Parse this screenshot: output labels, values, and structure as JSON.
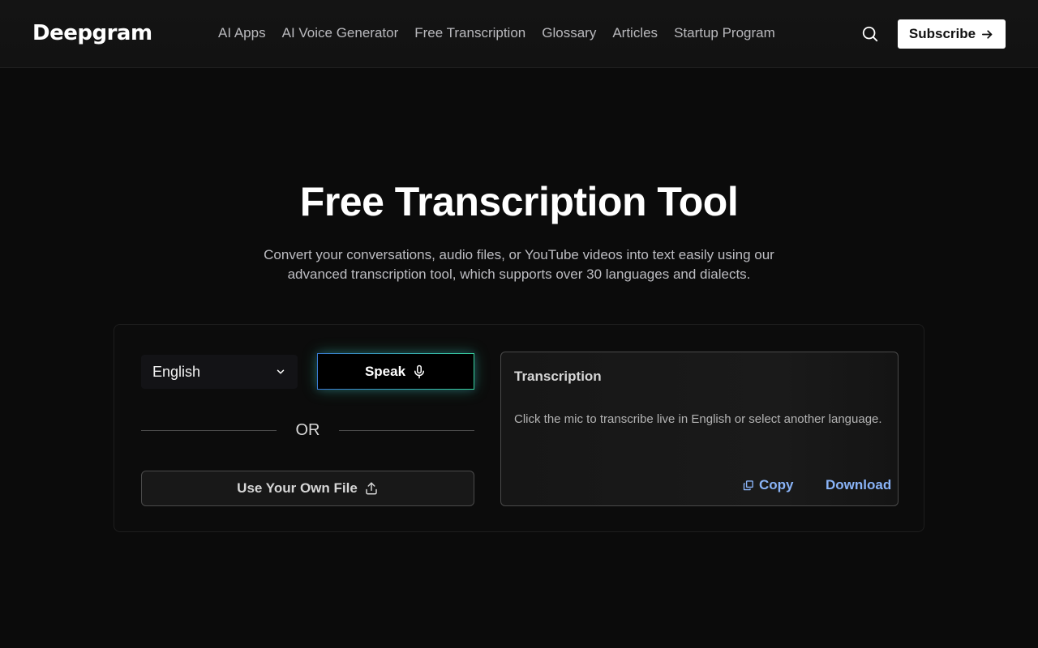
{
  "header": {
    "logo_text": "Deepgram",
    "nav": [
      {
        "label": "AI Apps"
      },
      {
        "label": "AI Voice Generator"
      },
      {
        "label": "Free Transcription"
      },
      {
        "label": "Glossary"
      },
      {
        "label": "Articles"
      },
      {
        "label": "Startup Program"
      }
    ],
    "search_icon": "search-icon",
    "subscribe_label": "Subscribe"
  },
  "hero": {
    "title": "Free Transcription Tool",
    "subtitle": "Convert your conversations, audio files, or YouTube videos into text easily using our advanced transcription tool, which supports over 30 languages and dialects."
  },
  "tool": {
    "language_selected": "English",
    "speak_label": "Speak",
    "or_label": "OR",
    "file_label": "Use Your Own File",
    "transcription": {
      "title": "Transcription",
      "placeholder": "Click the mic to transcribe live in English or select another language.",
      "copy_label": "Copy",
      "download_label": "Download"
    }
  },
  "colors": {
    "background": "#0b0b0b",
    "accent_link": "#8ab4f8",
    "speak_gradient_start": "#3a7bd5",
    "speak_gradient_end": "#38d39f"
  }
}
